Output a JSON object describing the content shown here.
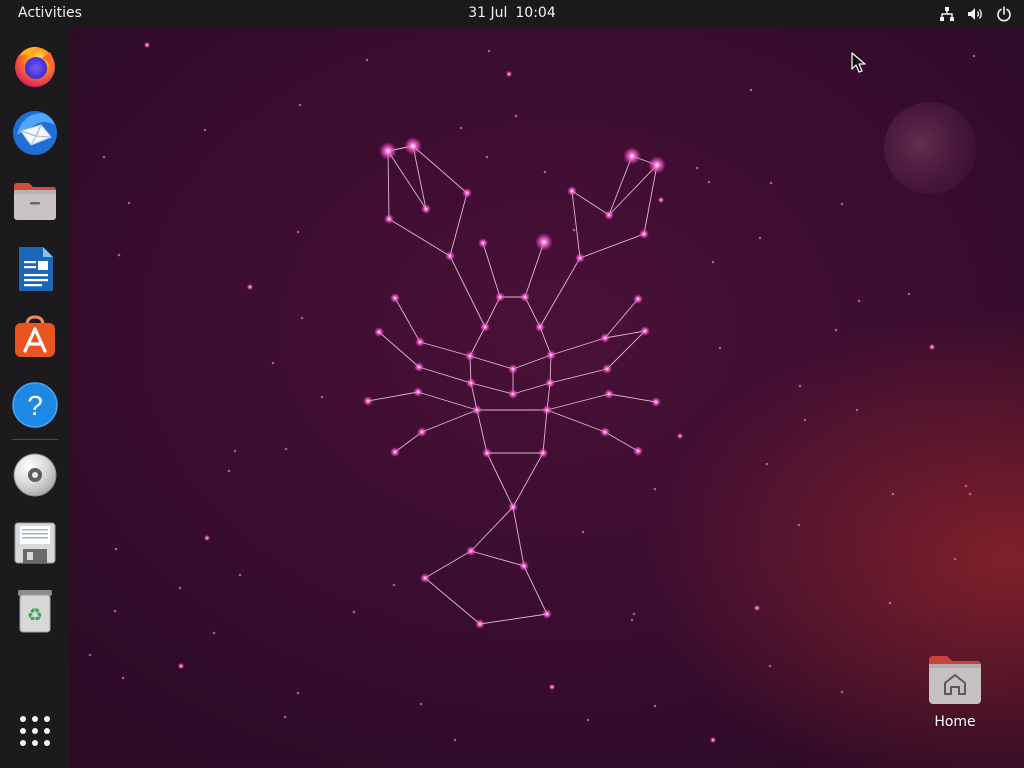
{
  "topbar": {
    "activities_label": "Activities",
    "date": "31 Jul",
    "time": "10:04",
    "tray_icons": [
      "network-wired-icon",
      "volume-icon",
      "power-icon"
    ]
  },
  "dock": {
    "items": [
      {
        "name": "firefox",
        "icon": "firefox-icon"
      },
      {
        "name": "thunderbird",
        "icon": "thunderbird-mail-icon"
      },
      {
        "name": "files",
        "icon": "files-folder-icon"
      },
      {
        "name": "libreoffice-writer",
        "icon": "libreoffice-writer-icon"
      },
      {
        "name": "ubuntu-software",
        "icon": "software-store-icon"
      },
      {
        "name": "help",
        "icon": "help-icon"
      },
      {
        "name": "optical-drive",
        "icon": "cd-disc-icon"
      },
      {
        "name": "floppy-drive",
        "icon": "floppy-disk-icon"
      },
      {
        "name": "trash",
        "icon": "trash-icon"
      }
    ],
    "show_apps_icon": "app-grid-icon"
  },
  "desktop": {
    "home_label": "Home",
    "wallpaper": "jammy-jellyfish-lobster-constellation"
  },
  "colors": {
    "topbar_bg": "#1a1a1a",
    "dock_bg": "#1d1a1e",
    "wallpaper_base": "#3a0d2f",
    "star_glow": "#ff5fd2",
    "ubuntu_orange": "#e95420"
  }
}
